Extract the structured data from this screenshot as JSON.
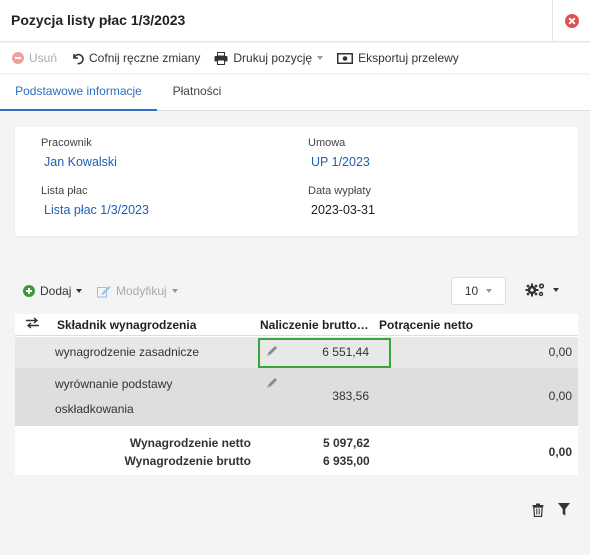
{
  "window": {
    "title": "Pozycja listy płac 1/3/2023"
  },
  "toolbar": {
    "delete": "Usuń",
    "undo": "Cofnij ręczne zmiany",
    "print": "Drukuj pozycję",
    "export": "Eksportuj przelewy"
  },
  "tabs": [
    {
      "label": "Podstawowe informacje",
      "active": true
    },
    {
      "label": "Płatności",
      "active": false
    }
  ],
  "info": {
    "employee_label": "Pracownik",
    "employee_value": "Jan Kowalski",
    "contract_label": "Umowa",
    "contract_value": "UP 1/2023",
    "payroll_label": "Lista płac",
    "payroll_value": "Lista płac 1/3/2023",
    "payout_label": "Data wypłaty",
    "payout_value": "2023-03-31"
  },
  "grid": {
    "add": "Dodaj",
    "modify": "Modyfikuj",
    "page_size": "10",
    "columns": {
      "component": "Składnik wynagrodzenia",
      "gross": "Naliczenie brutto…",
      "net_deduction": "Potrącenie netto"
    },
    "rows": [
      {
        "component": "wynagrodzenie zasadnicze",
        "gross": "6 551,44",
        "net": "0,00"
      },
      {
        "component_line1": "wyrównanie podstawy",
        "component_line2": "oskładkowania",
        "gross": "383,56",
        "net": "0,00"
      }
    ],
    "summary": {
      "net_label": "Wynagrodzenie netto",
      "net_value": "5 097,62",
      "gross_label": "Wynagrodzenie brutto",
      "gross_value": "6 935,00",
      "total": "0,00"
    }
  },
  "colors": {
    "accent": "#2d6fc2",
    "link": "#1f5fb3",
    "highlight": "#3aa63a",
    "danger": "#e05050",
    "add": "#3a9a3a"
  }
}
